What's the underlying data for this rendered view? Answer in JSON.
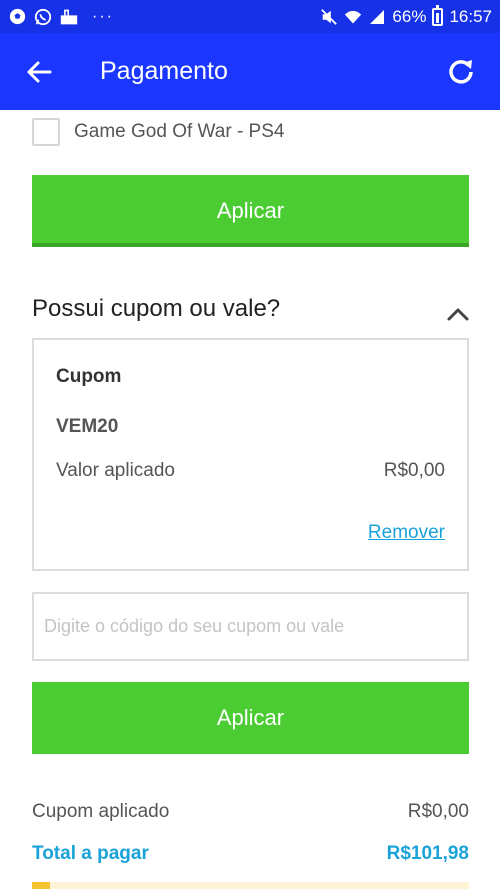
{
  "status_bar": {
    "battery": "66%",
    "time": "16:57",
    "icons": [
      "soccer-ball-icon",
      "whatsapp-icon",
      "voicemail-icon",
      "more-dots-icon",
      "mute-icon",
      "wifi-icon",
      "signal-icon",
      "battery-icon"
    ]
  },
  "app_bar": {
    "title": "Pagamento",
    "color": "#1a36ff"
  },
  "product": {
    "label": "Game God Of War - PS4",
    "checked": false
  },
  "buttons": {
    "apply_top": "Aplicar",
    "apply_bottom": "Aplicar",
    "color": "#4ccc33"
  },
  "coupon_section": {
    "title": "Possui cupom ou vale?",
    "card": {
      "label": "Cupom",
      "code": "VEM20",
      "applied_label": "Valor aplicado",
      "applied_value": "R$0,00",
      "remove": "Remover"
    },
    "input_placeholder": "Digite o código do seu cupom ou vale",
    "input_value": ""
  },
  "summary": {
    "applied_label": "Cupom aplicado",
    "applied_value": "R$0,00",
    "total_label": "Total a pagar",
    "total_value": "R$101,98",
    "accent": "#1aa3d9"
  }
}
